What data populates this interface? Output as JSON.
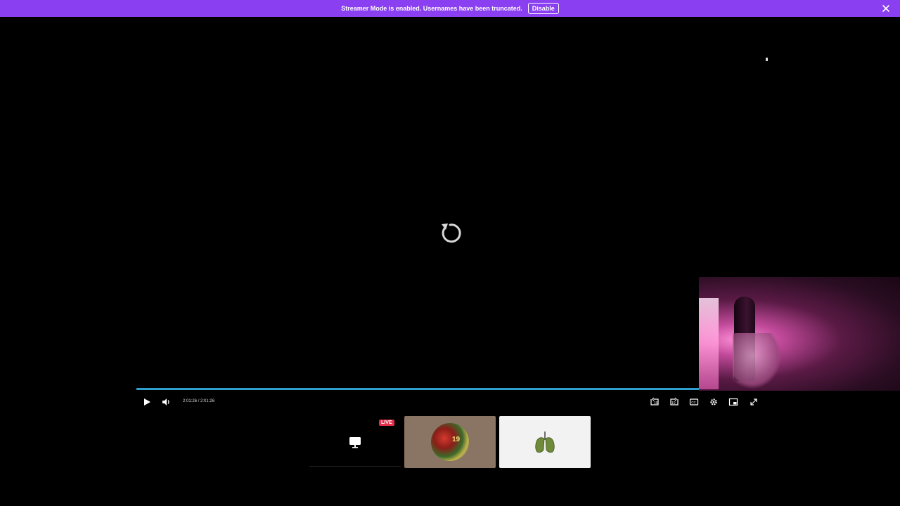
{
  "banner": {
    "message": "Streamer Mode is enabled. Usernames have been truncated.",
    "disable_label": "Disable",
    "background_color": "#8a3ff0"
  },
  "player": {
    "current_time": "2:01:26",
    "separator": "/",
    "duration": "2:01:26",
    "progress_fraction": 1.0,
    "progress_color": "#2d9fcf",
    "center_icon": "replay-icon",
    "controls": [
      "play-icon",
      "volume-icon",
      "rewind-10-icon",
      "forward-10-icon",
      "captions-icon",
      "settings-icon",
      "picture-in-picture-icon",
      "fullscreen-exit-icon"
    ]
  },
  "thumbnails": [
    {
      "badge": "LIVE",
      "icon": "screen-share-icon"
    },
    {
      "icon": "avatar-image",
      "jersey_number": "19"
    },
    {
      "icon": "lungs-icon"
    }
  ]
}
